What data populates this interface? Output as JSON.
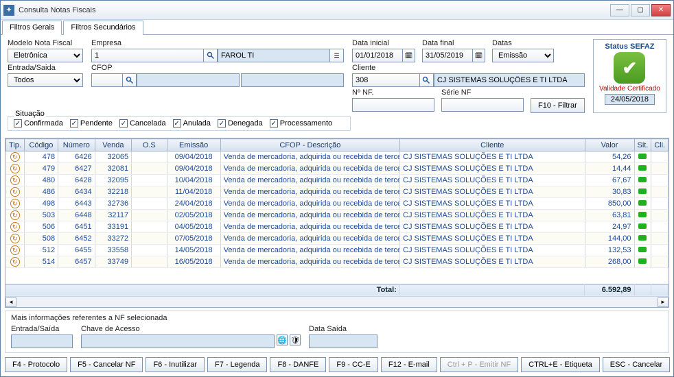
{
  "window": {
    "title": "Consulta Notas Fiscais"
  },
  "tabs": {
    "primary": "Filtros Gerais",
    "secondary": "Filtros Secundários"
  },
  "filters": {
    "modelo_label": "Modelo Nota Fiscal",
    "modelo_value": "Eletrônica",
    "empresa_label": "Empresa",
    "empresa_code": "1",
    "empresa_name": "FAROL TI",
    "data_inicial_label": "Data inicial",
    "data_inicial": "01/01/2018",
    "data_final_label": "Data final",
    "data_final": "31/05/2019",
    "datas_label": "Datas",
    "datas_value": "Emissão",
    "entrada_saida_label": "Entrada/Saida",
    "entrada_saida_value": "Todos",
    "cfop_label": "CFOP",
    "cfop_code": "",
    "cliente_label": "Cliente",
    "cliente_code": "308",
    "cliente_name": "CJ SISTEMAS SOLUÇÕES E TI LTDA",
    "nnf_label": "Nº NF.",
    "nnf_value": "",
    "serie_label": "Série NF",
    "serie_value": "",
    "filtrar_label": "F10 - Filtrar",
    "situacao_label": "Situação",
    "chk_confirmada": "Confirmada",
    "chk_pendente": "Pendente",
    "chk_cancelada": "Cancelada",
    "chk_anulada": "Anulada",
    "chk_denegada": "Denegada",
    "chk_processamento": "Processamento"
  },
  "status": {
    "header": "Status SEFAZ",
    "validade_label": "Validade Certificado",
    "validade_date": "24/05/2018"
  },
  "columns": {
    "tip": "Tip.",
    "codigo": "Código",
    "numero": "Número",
    "venda": "Venda",
    "os": "O.S",
    "emissao": "Emissão",
    "cfop": "CFOP - Descrição",
    "cliente": "Cliente",
    "valor": "Valor",
    "sit": "Sit.",
    "cli": "Cli."
  },
  "rows": [
    {
      "codigo": "478",
      "numero": "6426",
      "venda": "32065",
      "os": "",
      "emissao": "09/04/2018",
      "cfop": "Venda de mercadoria, adquirida ou recebida de terce",
      "cliente": "CJ SISTEMAS SOLUÇÕES E TI LTDA",
      "valor": "54,26"
    },
    {
      "codigo": "479",
      "numero": "6427",
      "venda": "32081",
      "os": "",
      "emissao": "09/04/2018",
      "cfop": "Venda de mercadoria, adquirida ou recebida de terce",
      "cliente": "CJ SISTEMAS SOLUÇÕES E TI LTDA",
      "valor": "14,44"
    },
    {
      "codigo": "480",
      "numero": "6428",
      "venda": "32095",
      "os": "",
      "emissao": "10/04/2018",
      "cfop": "Venda de mercadoria, adquirida ou recebida de terce",
      "cliente": "CJ SISTEMAS SOLUÇÕES E TI LTDA",
      "valor": "67,67"
    },
    {
      "codigo": "486",
      "numero": "6434",
      "venda": "32218",
      "os": "",
      "emissao": "11/04/2018",
      "cfop": "Venda de mercadoria, adquirida ou recebida de terce",
      "cliente": "CJ SISTEMAS SOLUÇÕES E TI LTDA",
      "valor": "30,83"
    },
    {
      "codigo": "498",
      "numero": "6443",
      "venda": "32736",
      "os": "",
      "emissao": "24/04/2018",
      "cfop": "Venda de mercadoria, adquirida ou recebida de terce",
      "cliente": "CJ SISTEMAS SOLUÇÕES E TI LTDA",
      "valor": "850,00"
    },
    {
      "codigo": "503",
      "numero": "6448",
      "venda": "32117",
      "os": "",
      "emissao": "02/05/2018",
      "cfop": "Venda de mercadoria, adquirida ou recebida de terce",
      "cliente": "CJ SISTEMAS SOLUÇÕES E TI LTDA",
      "valor": "63,81"
    },
    {
      "codigo": "506",
      "numero": "6451",
      "venda": "33191",
      "os": "",
      "emissao": "04/05/2018",
      "cfop": "Venda de mercadoria, adquirida ou recebida de terce",
      "cliente": "CJ SISTEMAS SOLUÇÕES E TI LTDA",
      "valor": "24,97"
    },
    {
      "codigo": "508",
      "numero": "6452",
      "venda": "33272",
      "os": "",
      "emissao": "07/05/2018",
      "cfop": "Venda de mercadoria, adquirida ou recebida de terce",
      "cliente": "CJ SISTEMAS SOLUÇÕES E TI LTDA",
      "valor": "144,00"
    },
    {
      "codigo": "512",
      "numero": "6455",
      "venda": "33558",
      "os": "",
      "emissao": "14/05/2018",
      "cfop": "Venda de mercadoria, adquirida ou recebida de terce",
      "cliente": "CJ SISTEMAS SOLUÇÕES E TI LTDA",
      "valor": "132,53"
    },
    {
      "codigo": "514",
      "numero": "6457",
      "venda": "33749",
      "os": "",
      "emissao": "16/05/2018",
      "cfop": "Venda de mercadoria, adquirida ou recebida de terce",
      "cliente": "CJ SISTEMAS SOLUÇÕES E TI LTDA",
      "valor": "268,00"
    }
  ],
  "totals": {
    "label": "Total:",
    "value": "6.592,89"
  },
  "detail": {
    "header": "Mais informações referentes a NF selecionada",
    "entrada_saida": "Entrada/Saída",
    "chave": "Chave de Acesso",
    "data_saida": "Data Saída"
  },
  "footer": {
    "f4": "F4 - Protocolo",
    "f5": "F5 - Cancelar NF",
    "f6": "F6 - Inutilizar",
    "f7": "F7 - Legenda",
    "f8": "F8 - DANFE",
    "f9": "F9 - CC-E",
    "f12": "F12 - E-mail",
    "ctrlp": "Ctrl + P - Emitir NF",
    "ctrle": "CTRL+E - Etiqueta",
    "esc": "ESC - Cancelar"
  }
}
